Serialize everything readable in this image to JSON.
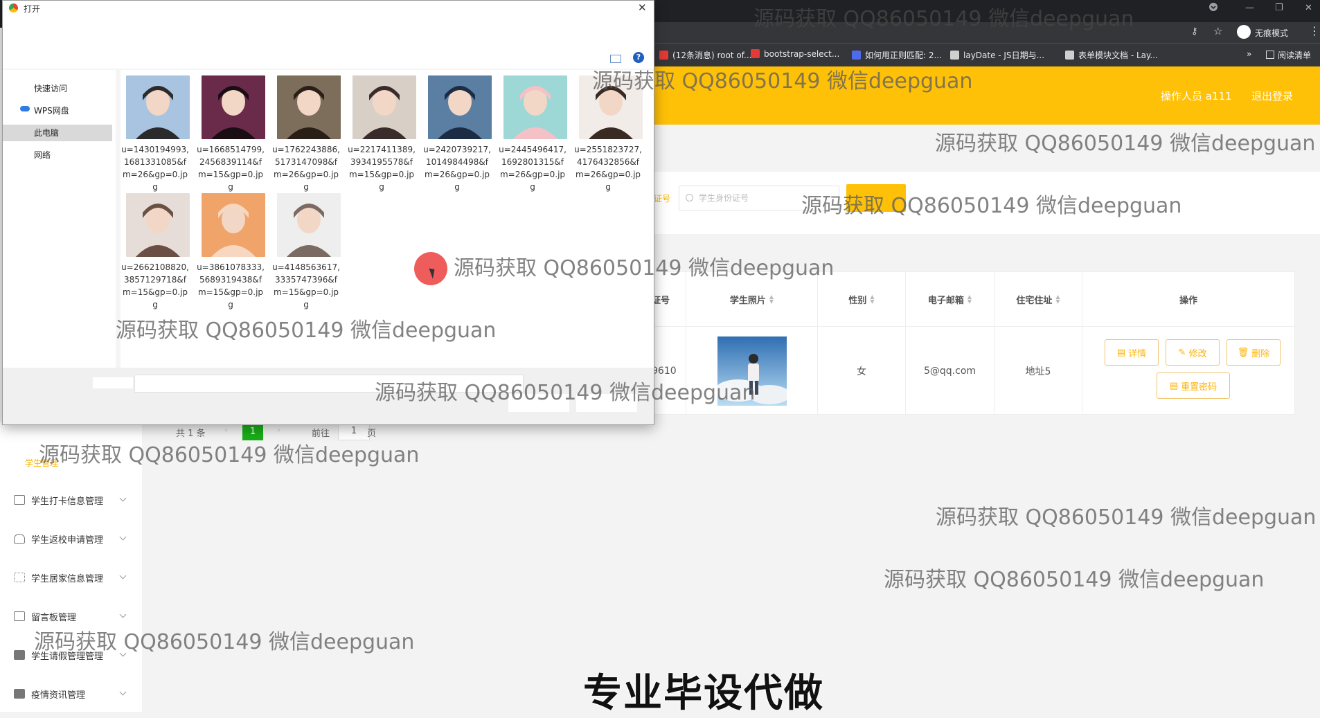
{
  "browser": {
    "incognito_label": "无痕模式",
    "bookmarks": [
      {
        "label": "(12条消息) root of...",
        "color": "#e53935"
      },
      {
        "label": "bootstrap-select...",
        "color": "#e53935"
      },
      {
        "label": "如何用正则匹配: 2...",
        "color": "#4f6bed"
      },
      {
        "label": "layDate - JS日期与...",
        "color": "#cfcfcf"
      },
      {
        "label": "表单模块文档 - Lay...",
        "color": "#cfcfcf"
      }
    ],
    "more_bookmarks": "»",
    "reading_list": "阅读清单"
  },
  "app": {
    "operator_label": "操作人员 a111",
    "logout_label": "退出登录",
    "search": {
      "label_fragment": "证号",
      "placeholder": "学生身份证号"
    },
    "table": {
      "columns": [
        "证号",
        "学生照片",
        "性别",
        "电子邮箱",
        "住宅住址",
        "操作"
      ],
      "row": {
        "id_fragment": "9610",
        "gender": "女",
        "email": "5@qq.com",
        "address": "地址5"
      },
      "actions": {
        "detail": "详情",
        "edit": "修改",
        "delete": "删除",
        "reset_password": "重置密码"
      }
    },
    "pagination": {
      "total": "共 1 条",
      "current": "1",
      "goto_prefix": "前往",
      "goto_value": "1",
      "goto_suffix": "页"
    },
    "sidebar": [
      {
        "label": "学生管理"
      },
      {
        "label": "学生打卡信息管理"
      },
      {
        "label": "学生返校申请管理"
      },
      {
        "label": "学生居家信息管理"
      },
      {
        "label": "留言板管理"
      },
      {
        "label": "学生请假管理管理"
      },
      {
        "label": "疫情资讯管理"
      }
    ]
  },
  "dialog": {
    "title": "打开",
    "close": "✕",
    "nav": [
      "快速访问",
      "WPS网盘",
      "此电脑",
      "网络"
    ],
    "selected_nav": "此电脑",
    "files": [
      {
        "name": "u=1430194993,1681331085&fm=26&gp=0.jpg",
        "colors": [
          "#a8c4e0",
          "#2b2b2b"
        ]
      },
      {
        "name": "u=1668514799,2456839114&fm=15&gp=0.jpg",
        "colors": [
          "#6a2a4a",
          "#1a0d14"
        ]
      },
      {
        "name": "u=1762243886,5173147098&fm=26&gp=0.jpg",
        "colors": [
          "#7d6d5b",
          "#2a1f17"
        ]
      },
      {
        "name": "u=2217411389,3934195578&fm=15&gp=0.jpg",
        "colors": [
          "#d8d0c6",
          "#3b2c2c"
        ]
      },
      {
        "name": "u=2420739217,1014984498&fm=26&gp=0.jpg",
        "colors": [
          "#5b7ea3",
          "#1c2c44"
        ]
      },
      {
        "name": "u=2445496417,1692801315&fm=26&gp=0.jpg",
        "colors": [
          "#9ed8d6",
          "#f4c1c7"
        ]
      },
      {
        "name": "u=2551823727,4176432856&fm=26&gp=0.jpg",
        "colors": [
          "#f1ece8",
          "#3a2a24"
        ]
      },
      {
        "name": "u=2662108820,3857129718&fm=15&gp=0.jpg",
        "colors": [
          "#e6ddd8",
          "#6b4f45"
        ]
      },
      {
        "name": "u=3861078333,5689319438&fm=15&gp=0.jpg",
        "colors": [
          "#f0a46a",
          "#f7d7bf"
        ]
      },
      {
        "name": "u=4148563617,3335747396&fm=15&gp=0.jpg",
        "colors": [
          "#eeeeee",
          "#7a6a62"
        ]
      }
    ]
  },
  "watermark": "源码获取 QQ86050149 微信deepguan",
  "caption": "专业毕设代做",
  "colors": {
    "accent": "#ffc107",
    "page_current": "#1aad19",
    "chrome_dark": "#202124"
  }
}
